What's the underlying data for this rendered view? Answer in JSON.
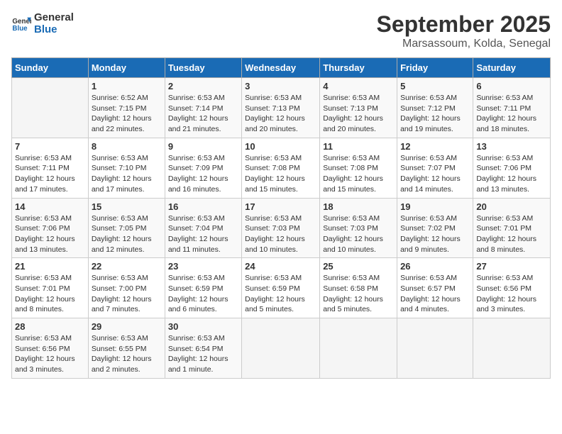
{
  "logo": {
    "line1": "General",
    "line2": "Blue"
  },
  "title": "September 2025",
  "subtitle": "Marsassoum, Kolda, Senegal",
  "headers": [
    "Sunday",
    "Monday",
    "Tuesday",
    "Wednesday",
    "Thursday",
    "Friday",
    "Saturday"
  ],
  "weeks": [
    [
      {
        "day": "",
        "info": ""
      },
      {
        "day": "1",
        "info": "Sunrise: 6:52 AM\nSunset: 7:15 PM\nDaylight: 12 hours\nand 22 minutes."
      },
      {
        "day": "2",
        "info": "Sunrise: 6:53 AM\nSunset: 7:14 PM\nDaylight: 12 hours\nand 21 minutes."
      },
      {
        "day": "3",
        "info": "Sunrise: 6:53 AM\nSunset: 7:13 PM\nDaylight: 12 hours\nand 20 minutes."
      },
      {
        "day": "4",
        "info": "Sunrise: 6:53 AM\nSunset: 7:13 PM\nDaylight: 12 hours\nand 20 minutes."
      },
      {
        "day": "5",
        "info": "Sunrise: 6:53 AM\nSunset: 7:12 PM\nDaylight: 12 hours\nand 19 minutes."
      },
      {
        "day": "6",
        "info": "Sunrise: 6:53 AM\nSunset: 7:11 PM\nDaylight: 12 hours\nand 18 minutes."
      }
    ],
    [
      {
        "day": "7",
        "info": "Sunrise: 6:53 AM\nSunset: 7:11 PM\nDaylight: 12 hours\nand 17 minutes."
      },
      {
        "day": "8",
        "info": "Sunrise: 6:53 AM\nSunset: 7:10 PM\nDaylight: 12 hours\nand 17 minutes."
      },
      {
        "day": "9",
        "info": "Sunrise: 6:53 AM\nSunset: 7:09 PM\nDaylight: 12 hours\nand 16 minutes."
      },
      {
        "day": "10",
        "info": "Sunrise: 6:53 AM\nSunset: 7:08 PM\nDaylight: 12 hours\nand 15 minutes."
      },
      {
        "day": "11",
        "info": "Sunrise: 6:53 AM\nSunset: 7:08 PM\nDaylight: 12 hours\nand 15 minutes."
      },
      {
        "day": "12",
        "info": "Sunrise: 6:53 AM\nSunset: 7:07 PM\nDaylight: 12 hours\nand 14 minutes."
      },
      {
        "day": "13",
        "info": "Sunrise: 6:53 AM\nSunset: 7:06 PM\nDaylight: 12 hours\nand 13 minutes."
      }
    ],
    [
      {
        "day": "14",
        "info": "Sunrise: 6:53 AM\nSunset: 7:06 PM\nDaylight: 12 hours\nand 13 minutes."
      },
      {
        "day": "15",
        "info": "Sunrise: 6:53 AM\nSunset: 7:05 PM\nDaylight: 12 hours\nand 12 minutes."
      },
      {
        "day": "16",
        "info": "Sunrise: 6:53 AM\nSunset: 7:04 PM\nDaylight: 12 hours\nand 11 minutes."
      },
      {
        "day": "17",
        "info": "Sunrise: 6:53 AM\nSunset: 7:03 PM\nDaylight: 12 hours\nand 10 minutes."
      },
      {
        "day": "18",
        "info": "Sunrise: 6:53 AM\nSunset: 7:03 PM\nDaylight: 12 hours\nand 10 minutes."
      },
      {
        "day": "19",
        "info": "Sunrise: 6:53 AM\nSunset: 7:02 PM\nDaylight: 12 hours\nand 9 minutes."
      },
      {
        "day": "20",
        "info": "Sunrise: 6:53 AM\nSunset: 7:01 PM\nDaylight: 12 hours\nand 8 minutes."
      }
    ],
    [
      {
        "day": "21",
        "info": "Sunrise: 6:53 AM\nSunset: 7:01 PM\nDaylight: 12 hours\nand 8 minutes."
      },
      {
        "day": "22",
        "info": "Sunrise: 6:53 AM\nSunset: 7:00 PM\nDaylight: 12 hours\nand 7 minutes."
      },
      {
        "day": "23",
        "info": "Sunrise: 6:53 AM\nSunset: 6:59 PM\nDaylight: 12 hours\nand 6 minutes."
      },
      {
        "day": "24",
        "info": "Sunrise: 6:53 AM\nSunset: 6:59 PM\nDaylight: 12 hours\nand 5 minutes."
      },
      {
        "day": "25",
        "info": "Sunrise: 6:53 AM\nSunset: 6:58 PM\nDaylight: 12 hours\nand 5 minutes."
      },
      {
        "day": "26",
        "info": "Sunrise: 6:53 AM\nSunset: 6:57 PM\nDaylight: 12 hours\nand 4 minutes."
      },
      {
        "day": "27",
        "info": "Sunrise: 6:53 AM\nSunset: 6:56 PM\nDaylight: 12 hours\nand 3 minutes."
      }
    ],
    [
      {
        "day": "28",
        "info": "Sunrise: 6:53 AM\nSunset: 6:56 PM\nDaylight: 12 hours\nand 3 minutes."
      },
      {
        "day": "29",
        "info": "Sunrise: 6:53 AM\nSunset: 6:55 PM\nDaylight: 12 hours\nand 2 minutes."
      },
      {
        "day": "30",
        "info": "Sunrise: 6:53 AM\nSunset: 6:54 PM\nDaylight: 12 hours\nand 1 minute."
      },
      {
        "day": "",
        "info": ""
      },
      {
        "day": "",
        "info": ""
      },
      {
        "day": "",
        "info": ""
      },
      {
        "day": "",
        "info": ""
      }
    ]
  ]
}
